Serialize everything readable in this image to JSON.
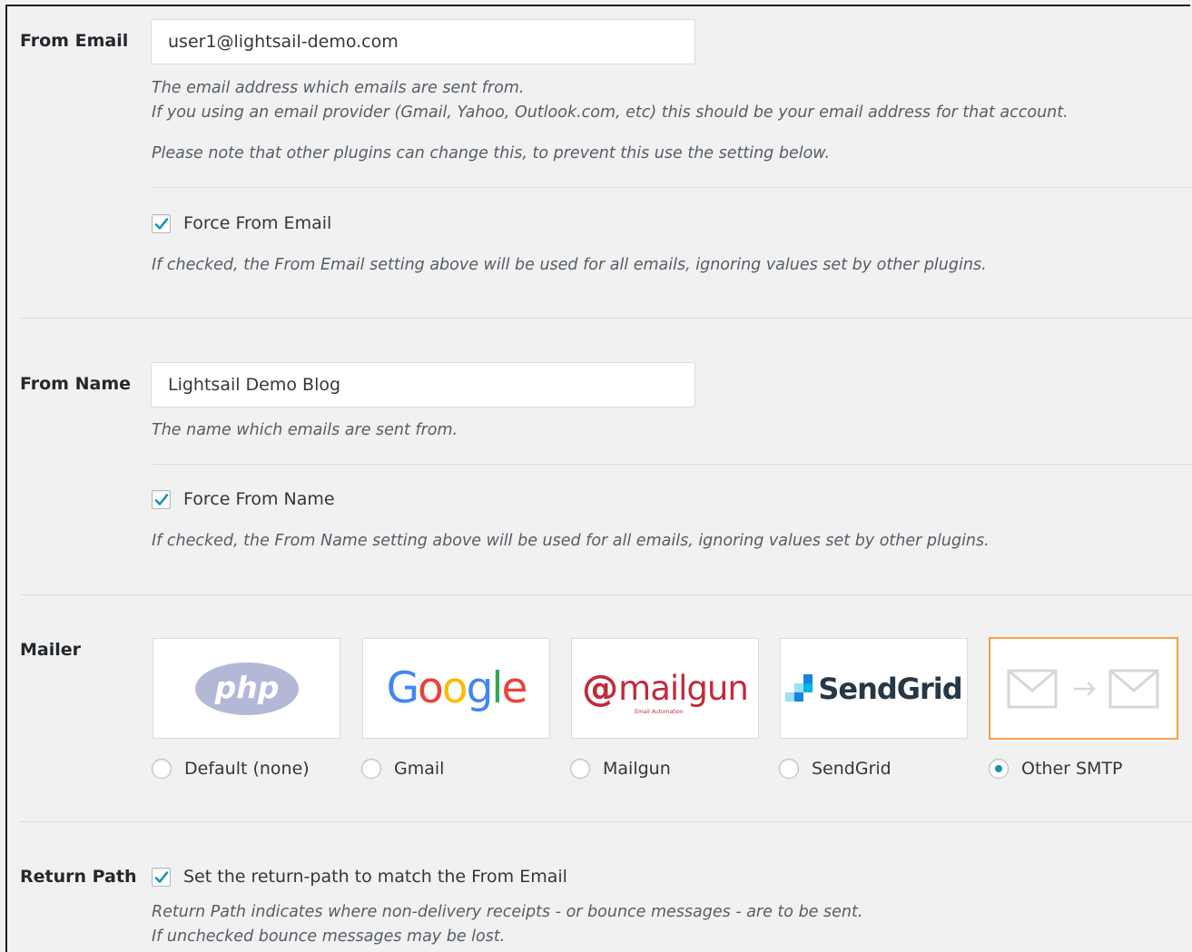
{
  "from_email": {
    "label": "From Email",
    "value": "user1@lightsail-demo.com",
    "desc_line1": "The email address which emails are sent from.",
    "desc_line2": "If you using an email provider (Gmail, Yahoo, Outlook.com, etc) this should be your email address for that account.",
    "desc_line3": "Please note that other plugins can change this, to prevent this use the setting below.",
    "force_label": "Force From Email",
    "force_checked": true,
    "force_desc": "If checked, the From Email setting above will be used for all emails, ignoring values set by other plugins."
  },
  "from_name": {
    "label": "From Name",
    "value": "Lightsail Demo Blog",
    "desc": "The name which emails are sent from.",
    "force_label": "Force From Name",
    "force_checked": true,
    "force_desc": "If checked, the From Name setting above will be used for all emails, ignoring values set by other plugins."
  },
  "mailer": {
    "label": "Mailer",
    "options": [
      {
        "label": "Default (none)",
        "logo_text": "php",
        "selected": false
      },
      {
        "label": "Gmail",
        "logo_text": "Google",
        "selected": false
      },
      {
        "label": "Mailgun",
        "logo_text": "mailgun",
        "logo_subtext": "Email Automation",
        "selected": false
      },
      {
        "label": "SendGrid",
        "logo_text": "SendGrid",
        "selected": false
      },
      {
        "label": "Other SMTP",
        "logo_text": "",
        "selected": true
      }
    ]
  },
  "return_path": {
    "label": "Return Path",
    "check_label": "Set the return-path to match the From Email",
    "checked": true,
    "desc_line1": "Return Path indicates where non-delivery receipts - or bounce messages - are to be sent.",
    "desc_line2": "If unchecked bounce messages may be lost."
  },
  "colors": {
    "accent": "#1e8cbe",
    "selected_border": "#f0a34a",
    "google_blue": "#4285f4",
    "google_red": "#ea4335",
    "google_yellow": "#fbbc05",
    "google_green": "#34a853",
    "mailgun_red": "#c02b3c",
    "sendgrid_text": "#263746",
    "php_blue": "#8892bf"
  }
}
